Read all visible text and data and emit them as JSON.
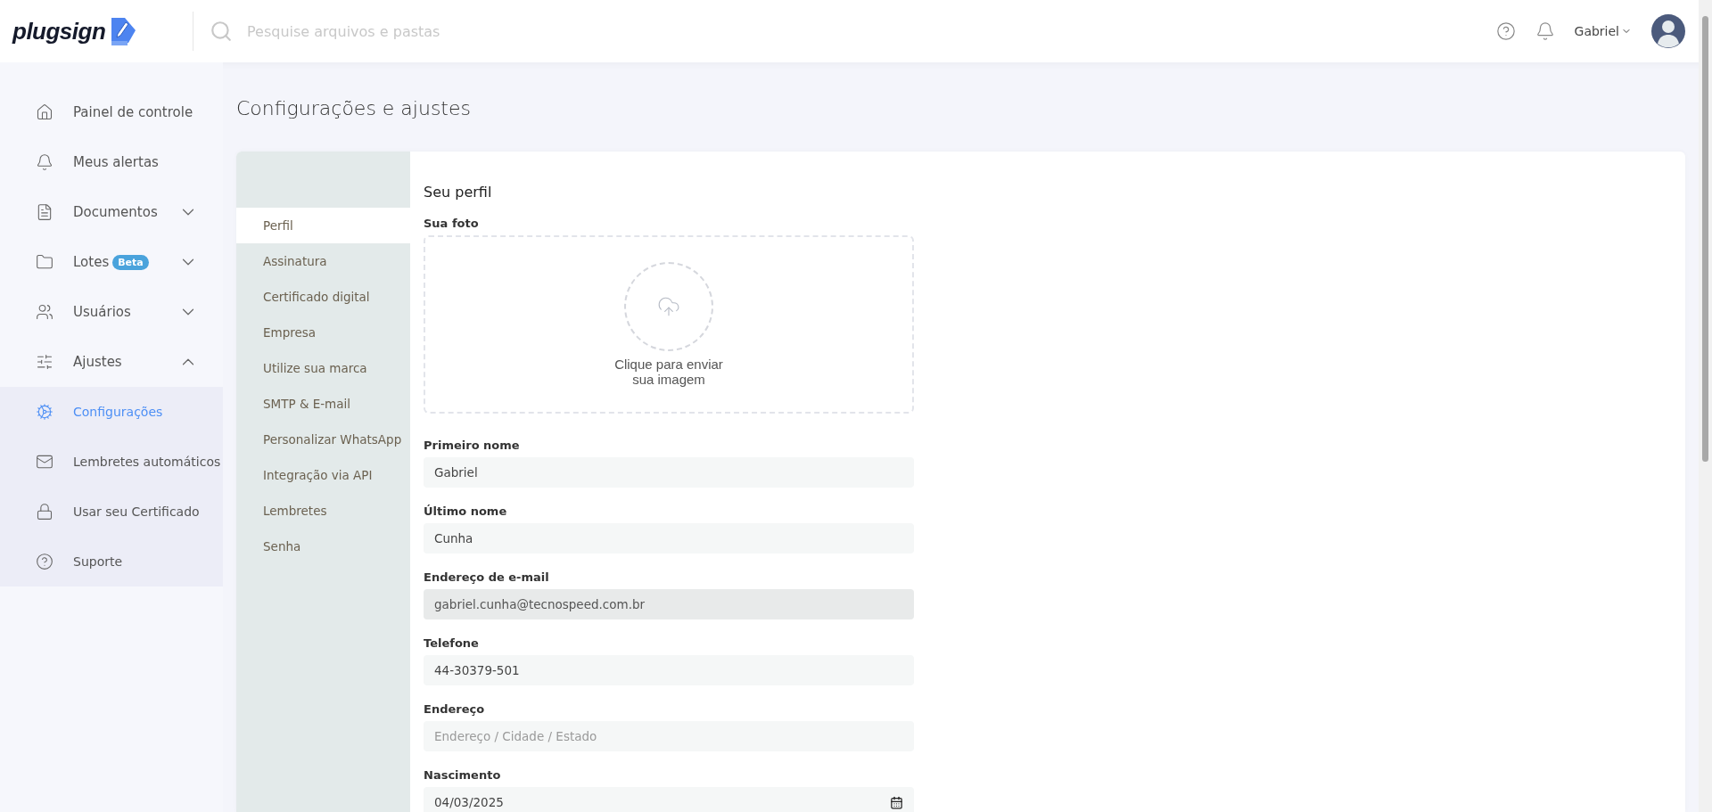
{
  "header": {
    "logo": "plugsign",
    "search": {
      "placeholder": "Pesquise arquivos e pastas"
    },
    "user": {
      "name": "Gabriel"
    }
  },
  "sidebar": {
    "items": [
      {
        "label": "Painel de controle",
        "selected": false,
        "highlighted": false
      },
      {
        "label": "Meus alertas",
        "selected": false,
        "highlighted": false
      },
      {
        "label": "Documentos",
        "selected": false,
        "highlighted": false,
        "expanded": false
      },
      {
        "label": "Lotes",
        "badge": "Beta",
        "selected": false,
        "highlighted": false,
        "expanded": false
      },
      {
        "label": "Usuários",
        "selected": false,
        "highlighted": false,
        "expanded": false
      },
      {
        "label": "Ajustes",
        "selected": false,
        "highlighted": false,
        "expanded": true
      },
      {
        "label": "Configurações",
        "selected": true,
        "highlighted": true
      },
      {
        "label": "Lembretes automáticos",
        "selected": false,
        "highlighted": true
      },
      {
        "label": "Usar seu Certificado",
        "selected": false,
        "highlighted": true
      },
      {
        "label": "Suporte",
        "selected": false,
        "highlighted": true
      }
    ]
  },
  "page": {
    "title": "Configurações e ajustes"
  },
  "settings_tabs": [
    {
      "label": "Perfil",
      "selected": true
    },
    {
      "label": "Assinatura",
      "selected": false
    },
    {
      "label": "Certificado digital",
      "selected": false
    },
    {
      "label": "Empresa",
      "selected": false
    },
    {
      "label": "Utilize sua marca",
      "selected": false
    },
    {
      "label": "SMTP & E-mail",
      "selected": false
    },
    {
      "label": "Personalizar WhatsApp",
      "selected": false
    },
    {
      "label": "Integração via API",
      "selected": false
    },
    {
      "label": "Lembretes",
      "selected": false
    },
    {
      "label": "Senha",
      "selected": false
    }
  ],
  "profile": {
    "title": "Seu perfil",
    "photo": {
      "label": "Sua foto",
      "hint_line_1": "Clique para enviar",
      "hint_line_2": "sua imagem"
    },
    "fields": [
      {
        "label": "Primeiro nome",
        "value": "Gabriel",
        "kind": "text",
        "disabled": false
      },
      {
        "label": "Último nome",
        "value": "Cunha",
        "kind": "text",
        "disabled": false
      },
      {
        "label": "Endereço de e-mail",
        "value": "gabriel.cunha@tecnospeed.com.br",
        "kind": "text",
        "disabled": true
      },
      {
        "label": "Telefone",
        "value": "44-30379-501",
        "kind": "text",
        "disabled": false
      },
      {
        "label": "Endereço",
        "placeholder": "Endereço / Cidade / Estado",
        "kind": "text",
        "disabled": false
      },
      {
        "label": "Nascimento",
        "value": "04/03/2025",
        "kind": "date"
      }
    ]
  }
}
